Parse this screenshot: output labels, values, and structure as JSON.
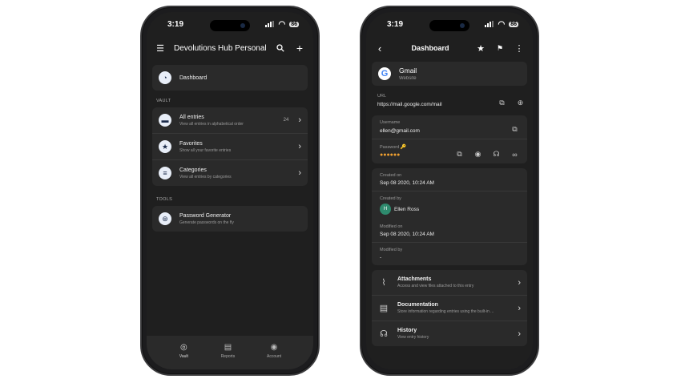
{
  "left": {
    "status": {
      "time": "3:19",
      "battery": "86"
    },
    "appbar": {
      "title": "Devolutions Hub Personal"
    },
    "dashboard": {
      "label": "Dashboard"
    },
    "vault_section": "VAULT",
    "vault_items": [
      {
        "title": "All entries",
        "subtitle": "View all entries in alphabetical order",
        "count": "24"
      },
      {
        "title": "Favorites",
        "subtitle": "Show all your favorite entries"
      },
      {
        "title": "Categories",
        "subtitle": "View all entries by categories"
      }
    ],
    "tools_section": "TOOLS",
    "tools_items": [
      {
        "title": "Password Generator",
        "subtitle": "Generate passwords on the fly"
      }
    ],
    "tabs": [
      {
        "label": "Vault"
      },
      {
        "label": "Reports"
      },
      {
        "label": "Account"
      }
    ]
  },
  "right": {
    "status": {
      "time": "3:19",
      "battery": "86"
    },
    "appbar": {
      "title": "Dashboard"
    },
    "entry": {
      "name": "Gmail",
      "type": "Website"
    },
    "url": {
      "label": "URL",
      "value": "https://mail.google.com/mail"
    },
    "username": {
      "label": "Username",
      "value": "ellen@gmail.com"
    },
    "password": {
      "label": "Password",
      "masked": "●●●●●●"
    },
    "created_on": {
      "label": "Created on",
      "value": "Sep 08 2020, 10:24 AM"
    },
    "created_by": {
      "label": "Created by",
      "initials": "H",
      "value": "Ellen Ross"
    },
    "modified_on": {
      "label": "Modified on",
      "value": "Sep 08 2020, 10:24 AM"
    },
    "modified_by": {
      "label": "Modified by",
      "value": "-"
    },
    "sections": [
      {
        "title": "Attachments",
        "subtitle": "Access and view files attached to this entry"
      },
      {
        "title": "Documentation",
        "subtitle": "Store information regarding entries using the built-in ..."
      },
      {
        "title": "History",
        "subtitle": "View entry history"
      }
    ]
  }
}
